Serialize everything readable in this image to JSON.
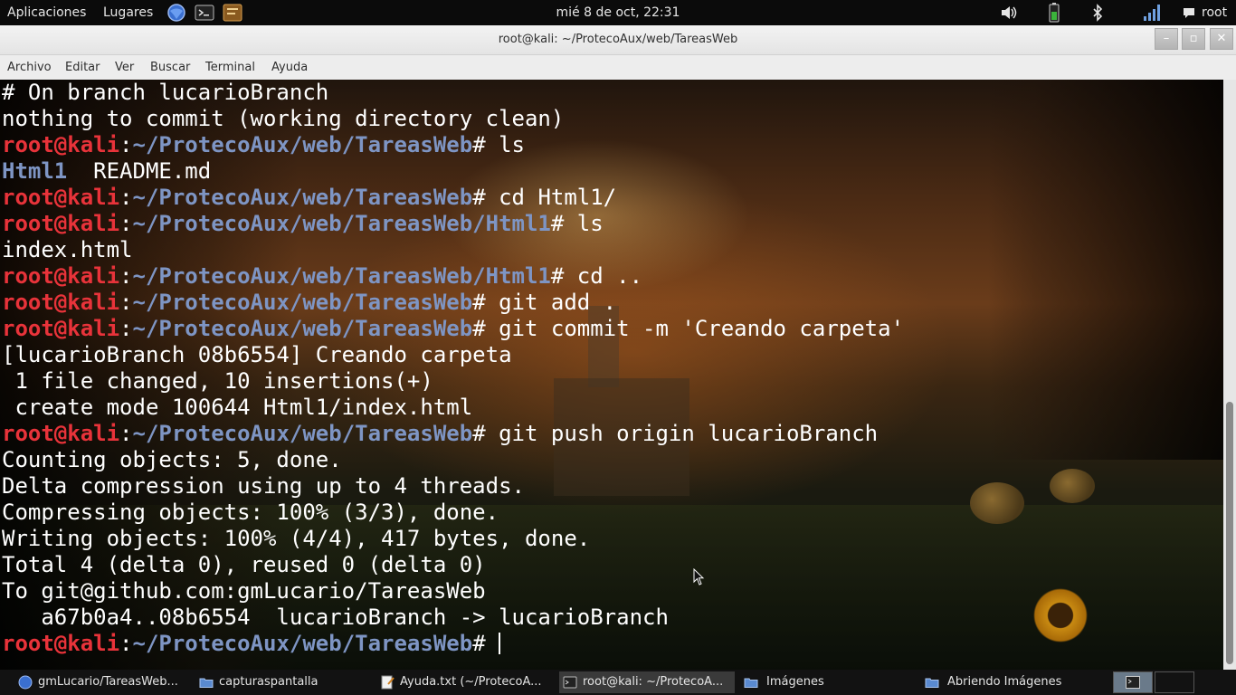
{
  "top_panel": {
    "applications": "Aplicaciones",
    "places": "Lugares",
    "clock": "mié  8 de oct, 22:31",
    "user": "root",
    "launchers": [
      "browser-icon",
      "terminal-icon",
      "notes-icon"
    ],
    "tray": [
      "volume-icon",
      "battery-icon",
      "bluetooth-icon",
      "signal-icon",
      "chat-icon"
    ]
  },
  "window": {
    "title": "root@kali: ~/ProtecoAux/web/TareasWeb",
    "minimize": "–",
    "maximize": "▫",
    "close": "✕"
  },
  "menubar": [
    "Archivo",
    "Editar",
    "Ver",
    "Buscar",
    "Terminal",
    "Ayuda"
  ],
  "terminal": {
    "lines": [
      "# On branch lucarioBranch",
      "nothing to commit (working directory clean)",
      {
        "user": "root@kali",
        "path": "~/ProtecoAux/web/TareasWeb",
        "cmd": " ls"
      },
      {
        "dir": "Html1",
        "rest": "  README.md"
      },
      {
        "user": "root@kali",
        "path": "~/ProtecoAux/web/TareasWeb",
        "cmd": " cd Html1/"
      },
      {
        "user": "root@kali",
        "path": "~/ProtecoAux/web/TareasWeb/Html1",
        "cmd": " ls"
      },
      "index.html",
      {
        "user": "root@kali",
        "path": "~/ProtecoAux/web/TareasWeb/Html1",
        "cmd": " cd .."
      },
      {
        "user": "root@kali",
        "path": "~/ProtecoAux/web/TareasWeb",
        "cmd": " git add ."
      },
      {
        "user": "root@kali",
        "path": "~/ProtecoAux/web/TareasWeb",
        "cmd": " git commit -m 'Creando carpeta'"
      },
      "[lucarioBranch 08b6554] Creando carpeta",
      " 1 file changed, 10 insertions(+)",
      " create mode 100644 Html1/index.html",
      {
        "user": "root@kali",
        "path": "~/ProtecoAux/web/TareasWeb",
        "cmd": " git push origin lucarioBranch"
      },
      "Counting objects: 5, done.",
      "Delta compression using up to 4 threads.",
      "Compressing objects: 100% (3/3), done.",
      "Writing objects: 100% (4/4), 417 bytes, done.",
      "Total 4 (delta 0), reused 0 (delta 0)",
      "To git@github.com:gmLucario/TareasWeb",
      "   a67b0a4..08b6554  lucarioBranch -> lucarioBranch",
      {
        "user": "root@kali",
        "path": "~/ProtecoAux/web/TareasWeb",
        "cmd": " ",
        "cursor": true
      }
    ],
    "colors": {
      "prompt_user": "#e8333a",
      "prompt_path": "#7e95c4",
      "text": "#ffffff"
    }
  },
  "taskbar": {
    "tasks": [
      {
        "label": "gmLucario/TareasWeb...",
        "icon": "browser-icon"
      },
      {
        "label": "capturaspantalla",
        "icon": "folder-icon"
      },
      {
        "label": "Ayuda.txt (~/ProtecoA...",
        "icon": "text-editor-icon"
      },
      {
        "label": "root@kali: ~/ProtecoA...",
        "icon": "terminal-icon",
        "active": true
      },
      {
        "label": "Imágenes",
        "icon": "folder-icon"
      },
      {
        "label": "Abriendo Imágenes",
        "icon": "folder-icon"
      }
    ]
  }
}
